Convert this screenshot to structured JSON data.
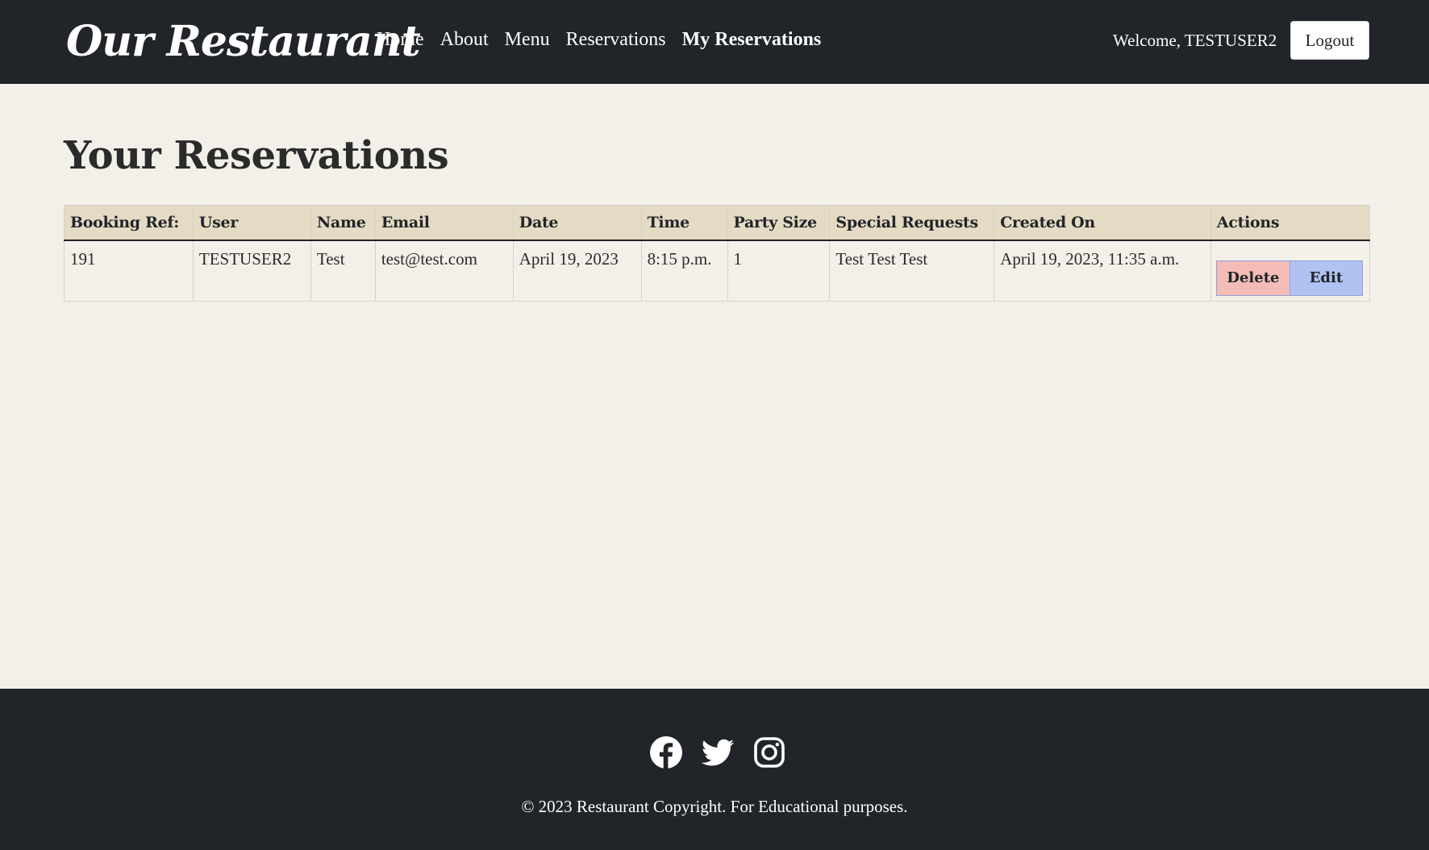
{
  "navbar": {
    "brand": "Our Restaurant",
    "links": [
      {
        "label": "Home"
      },
      {
        "label": "About"
      },
      {
        "label": "Menu"
      },
      {
        "label": "Reservations"
      },
      {
        "label": "My Reservations",
        "active": true
      }
    ],
    "welcome": "Welcome, TESTUSER2",
    "logout_label": "Logout"
  },
  "main": {
    "title": "Your Reservations",
    "table": {
      "headers": [
        "Booking Ref:",
        "User",
        "Name",
        "Email",
        "Date",
        "Time",
        "Party Size",
        "Special Requests",
        "Created On",
        "Actions"
      ],
      "rows": [
        {
          "booking_ref": "191",
          "user": "TESTUSER2",
          "name": "Test",
          "email": "test@test.com",
          "date": "April 19, 2023",
          "time": "8:15 p.m.",
          "party_size": "1",
          "special_requests": "Test Test Test",
          "created_on": "April 19, 2023, 11:35 a.m.",
          "delete_label": "Delete",
          "edit_label": "Edit"
        }
      ]
    }
  },
  "footer": {
    "social_icons": [
      "facebook-icon",
      "twitter-icon",
      "instagram-icon"
    ],
    "copyright": "© 2023 Restaurant Copyright. For Educational purposes."
  },
  "colors": {
    "navbar_bg": "#212529",
    "page_bg": "#f3f0e9",
    "table_header_bg": "#e5dac3",
    "delete_bg": "#f3bcb6",
    "edit_bg": "#b0c2f1"
  }
}
